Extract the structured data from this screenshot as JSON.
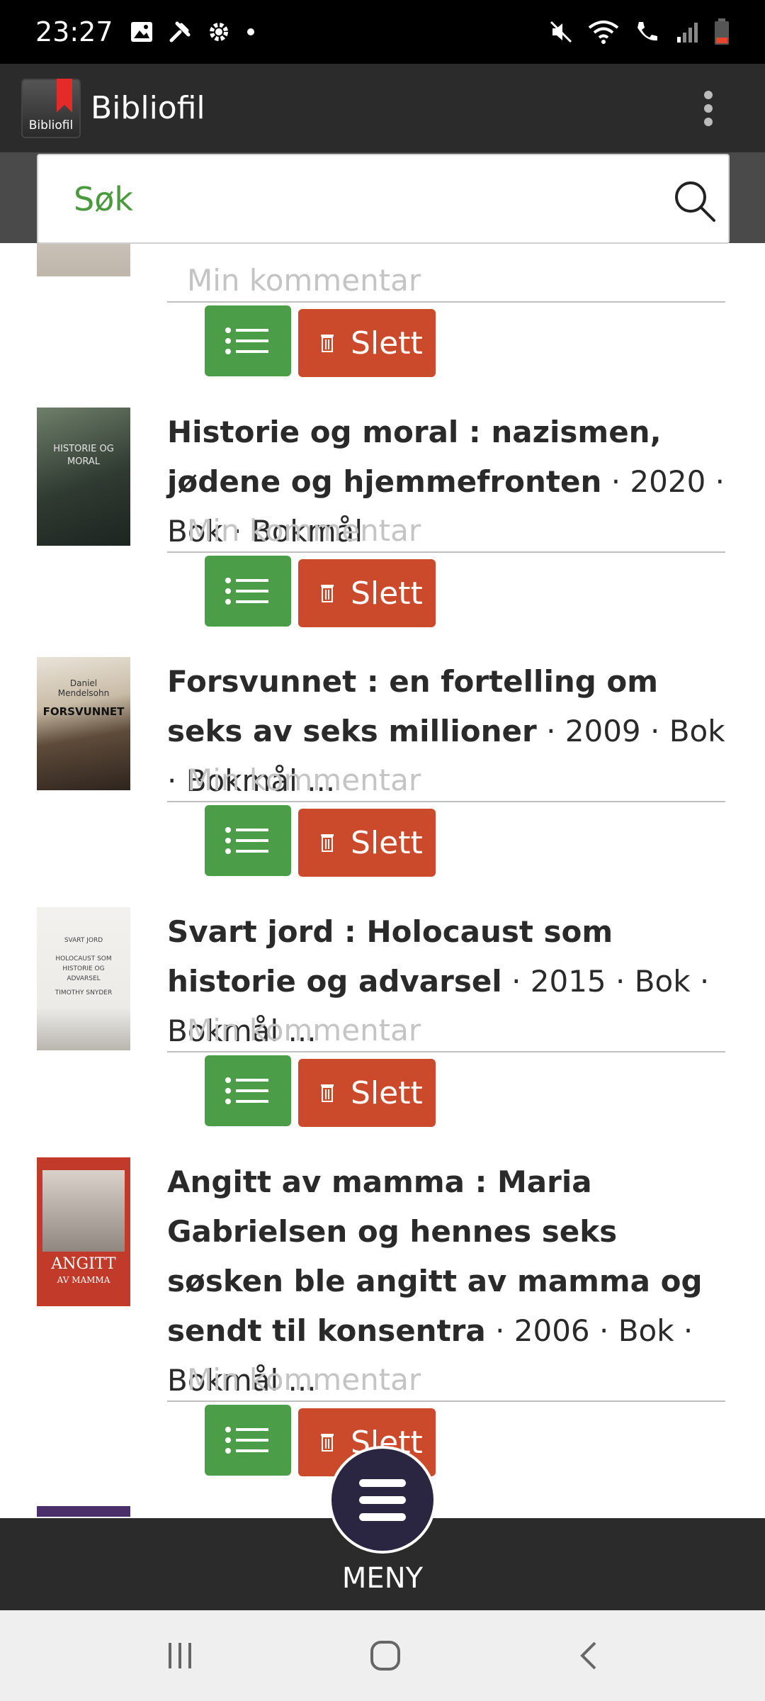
{
  "status_bar": {
    "time": "23:27",
    "icons_left": [
      "image-icon",
      "tools-icon",
      "gear-icon",
      "dot-icon"
    ],
    "icons_right": [
      "mute-icon",
      "wifi-icon",
      "volte-call-icon",
      "signal-icon",
      "battery-icon"
    ]
  },
  "app_bar": {
    "logo_text": "Bibliofil",
    "title": "Bibliofil",
    "overflow_icon": "more-vert-icon"
  },
  "search": {
    "placeholder": "Søk",
    "icon": "search-icon"
  },
  "books": [
    {
      "title": "",
      "meta": "",
      "comment_placeholder": "Min kommentar",
      "delete_label": "Slett"
    },
    {
      "title": "Historie og moral : nazismen, jødene og hjemmefronten",
      "meta": " · 2020 · Bok · Bokmål",
      "comment_placeholder": "Min kommentar",
      "delete_label": "Slett",
      "cover_text": "HISTORIE OG MORAL"
    },
    {
      "title": "Forsvunnet : en fortelling om seks av seks millioner",
      "meta": " · 2009 · Bok · Bokmål ...",
      "comment_placeholder": "Min kommentar",
      "delete_label": "Slett",
      "cover_text_author": "Daniel Mendelsohn",
      "cover_text": "FORSVUNNET"
    },
    {
      "title": "Svart jord : Holocaust som historie og advarsel",
      "meta": " · 2015 · Bok · Bokmål ...",
      "comment_placeholder": "Min kommentar",
      "delete_label": "Slett",
      "cover_text_top": "SVART JORD",
      "cover_text": "HOLOCAUST SOM HISTORIE OG ADVARSEL",
      "cover_text_author": "TIMOTHY SNYDER"
    },
    {
      "title": "Angitt av mamma : Maria Gabrielsen og hennes seks søsken ble angitt av mamma og sendt til konsentra",
      "meta": " · 2006 · Bok · Bokmål ...",
      "comment_placeholder": "Min kommentar",
      "delete_label": "Slett",
      "cover_text": "ANGITT",
      "cover_text_sub": "AV MAMMA"
    }
  ],
  "bottom_menu": {
    "label": "MENY",
    "icon": "hamburger-icon"
  },
  "nav_bar": {
    "icons": [
      "recent-apps-icon",
      "home-icon",
      "back-icon"
    ]
  },
  "colors": {
    "list_button": "#4b9e47",
    "delete_button": "#cc4a2c",
    "app_bar": "#2b2b2b",
    "search_text": "#4a9a3d",
    "menu_fab": "#2a2540"
  }
}
